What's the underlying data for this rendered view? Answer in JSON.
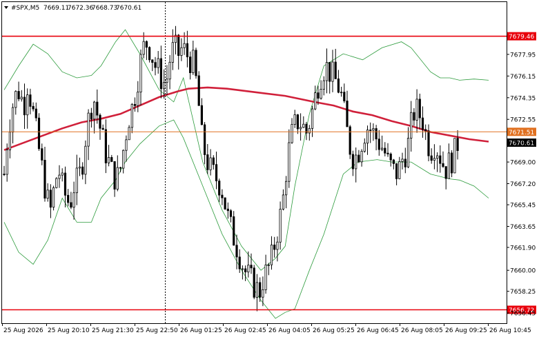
{
  "header": {
    "symbol": "#SPX,M5",
    "open": "7669.11",
    "high": "7672.36",
    "low": "7668.73",
    "close": "7670.61"
  },
  "chart_data": {
    "type": "candlestick",
    "symbol": "#SPX",
    "timeframe": "M5",
    "grid": false,
    "ylim": [
      7655.6,
      7682.3
    ],
    "y_ticks": [
      "7677.95",
      "7676.15",
      "7674.35",
      "7672.55",
      "7670.75",
      "7669.00",
      "7667.20",
      "7665.45",
      "7663.65",
      "7661.90",
      "7660.00",
      "7658.25",
      "7656.45"
    ],
    "x_ticks": [
      "25 Aug 2026",
      "25 Aug 20:10",
      "25 Aug 21:30",
      "25 Aug 22:50",
      "26 Aug 01:25",
      "26 Aug 02:45",
      "26 Aug 04:05",
      "26 Aug 05:25",
      "26 Aug 06:45",
      "26 Aug 08:05",
      "26 Aug 09:25",
      "26 Aug 10:45"
    ],
    "levels": [
      {
        "value": "7679.46",
        "color": "#e8000b"
      },
      {
        "value": "7671.51",
        "color": "#e07020"
      },
      {
        "value": "7656.72",
        "color": "#e8000b"
      }
    ],
    "current_price": "7670.61",
    "indicators": {
      "moving_average_color": "#d0203a",
      "bollinger_color": "#2a9a3a",
      "moving_average": [
        [
          0,
          7670.0
        ],
        [
          20,
          7670.6
        ],
        [
          40,
          7671.2
        ],
        [
          60,
          7671.8
        ],
        [
          80,
          7672.3
        ],
        [
          100,
          7672.6
        ],
        [
          120,
          7673.0
        ],
        [
          140,
          7673.7
        ],
        [
          160,
          7674.4
        ],
        [
          180,
          7674.9
        ],
        [
          190,
          7675.1
        ],
        [
          210,
          7675.2
        ],
        [
          230,
          7675.1
        ],
        [
          260,
          7674.8
        ],
        [
          290,
          7674.5
        ],
        [
          320,
          7674.0
        ],
        [
          340,
          7673.7
        ],
        [
          360,
          7673.2
        ],
        [
          380,
          7672.9
        ],
        [
          400,
          7672.4
        ],
        [
          420,
          7672.0
        ],
        [
          440,
          7671.5
        ],
        [
          460,
          7671.2
        ],
        [
          480,
          7670.9
        ],
        [
          500,
          7670.7
        ]
      ],
      "bollinger_upper": [
        [
          0,
          7675.0
        ],
        [
          15,
          7677.0
        ],
        [
          30,
          7678.8
        ],
        [
          45,
          7678.0
        ],
        [
          60,
          7676.5
        ],
        [
          75,
          7676.0
        ],
        [
          90,
          7676.2
        ],
        [
          100,
          7677.0
        ],
        [
          115,
          7679.0
        ],
        [
          125,
          7680.0
        ],
        [
          140,
          7678.0
        ],
        [
          160,
          7675.0
        ],
        [
          175,
          7674.0
        ],
        [
          185,
          7676.0
        ],
        [
          205,
          7669.0
        ],
        [
          225,
          7665.0
        ],
        [
          245,
          7662.0
        ],
        [
          265,
          7660.0
        ],
        [
          280,
          7661.0
        ],
        [
          290,
          7662.0
        ],
        [
          300,
          7667.0
        ],
        [
          315,
          7673.0
        ],
        [
          330,
          7677.0
        ],
        [
          350,
          7678.0
        ],
        [
          370,
          7677.5
        ],
        [
          390,
          7678.5
        ],
        [
          410,
          7679.0
        ],
        [
          420,
          7678.5
        ],
        [
          440,
          7676.5
        ],
        [
          450,
          7676.0
        ],
        [
          460,
          7676.0
        ],
        [
          470,
          7675.8
        ],
        [
          485,
          7675.9
        ],
        [
          500,
          7675.8
        ]
      ],
      "bollinger_lower": [
        [
          0,
          7664.0
        ],
        [
          15,
          7661.5
        ],
        [
          30,
          7660.5
        ],
        [
          45,
          7662.5
        ],
        [
          60,
          7666.0
        ],
        [
          75,
          7664.0
        ],
        [
          90,
          7664.0
        ],
        [
          100,
          7666.0
        ],
        [
          115,
          7667.5
        ],
        [
          125,
          7669.0
        ],
        [
          140,
          7670.5
        ],
        [
          160,
          7672.0
        ],
        [
          175,
          7672.5
        ],
        [
          185,
          7671.0
        ],
        [
          205,
          7667.0
        ],
        [
          225,
          7663.0
        ],
        [
          245,
          7660.0
        ],
        [
          265,
          7657.5
        ],
        [
          280,
          7656.0
        ],
        [
          290,
          7656.5
        ],
        [
          300,
          7656.8
        ],
        [
          315,
          7660.0
        ],
        [
          330,
          7663.0
        ],
        [
          350,
          7668.0
        ],
        [
          365,
          7669.0
        ],
        [
          385,
          7669.2
        ],
        [
          400,
          7669.0
        ],
        [
          420,
          7669.0
        ],
        [
          440,
          7668.0
        ],
        [
          450,
          7667.8
        ],
        [
          460,
          7667.6
        ],
        [
          470,
          7667.5
        ],
        [
          485,
          7667.0
        ],
        [
          500,
          7666.0
        ]
      ]
    },
    "candle_path": [
      [
        0,
        7668.0
      ],
      [
        4,
        7671.5
      ],
      [
        8,
        7673.5
      ],
      [
        12,
        7674.5
      ],
      [
        16,
        7675.0
      ],
      [
        20,
        7673.5
      ],
      [
        24,
        7675.5
      ],
      [
        28,
        7674.0
      ],
      [
        32,
        7672.0
      ],
      [
        36,
        7670.0
      ],
      [
        40,
        7668.0
      ],
      [
        44,
        7666.0
      ],
      [
        48,
        7665.0
      ],
      [
        52,
        7667.0
      ],
      [
        56,
        7668.5
      ],
      [
        60,
        7667.0
      ],
      [
        64,
        7666.0
      ],
      [
        68,
        7665.5
      ],
      [
        72,
        7667.0
      ],
      [
        76,
        7667.5
      ],
      [
        80,
        7668.5
      ],
      [
        84,
        7671.0
      ],
      [
        88,
        7673.0
      ],
      [
        92,
        7674.5
      ],
      [
        96,
        7673.0
      ],
      [
        100,
        7671.5
      ],
      [
        104,
        7670.0
      ],
      [
        108,
        7669.0
      ],
      [
        112,
        7668.0
      ],
      [
        116,
        7667.5
      ],
      [
        120,
        7668.5
      ],
      [
        124,
        7670.5
      ],
      [
        128,
        7672.5
      ],
      [
        132,
        7673.5
      ],
      [
        136,
        7675.0
      ],
      [
        140,
        7677.0
      ],
      [
        144,
        7678.5
      ],
      [
        148,
        7679.0
      ],
      [
        152,
        7678.0
      ],
      [
        156,
        7677.0
      ],
      [
        160,
        7676.5
      ],
      [
        164,
        7675.5
      ],
      [
        168,
        7676.0
      ],
      [
        172,
        7678.0
      ],
      [
        176,
        7678.5
      ],
      [
        180,
        7678.0
      ],
      [
        184,
        7678.5
      ],
      [
        188,
        7678.0
      ],
      [
        192,
        7677.5
      ],
      [
        196,
        7677.0
      ],
      [
        200,
        7674.5
      ],
      [
        204,
        7671.0
      ],
      [
        208,
        7669.5
      ],
      [
        212,
        7668.5
      ],
      [
        216,
        7668.0
      ],
      [
        220,
        7667.5
      ],
      [
        224,
        7667.0
      ],
      [
        228,
        7665.5
      ],
      [
        232,
        7664.0
      ],
      [
        236,
        7663.0
      ],
      [
        240,
        7662.0
      ],
      [
        244,
        7661.0
      ],
      [
        248,
        7660.0
      ],
      [
        252,
        7659.5
      ],
      [
        256,
        7659.0
      ],
      [
        260,
        7658.5
      ],
      [
        264,
        7658.3
      ],
      [
        268,
        7659.5
      ],
      [
        272,
        7660.0
      ],
      [
        276,
        7661.0
      ],
      [
        280,
        7662.5
      ],
      [
        284,
        7664.0
      ],
      [
        288,
        7666.0
      ],
      [
        292,
        7669.0
      ],
      [
        296,
        7671.0
      ],
      [
        300,
        7672.0
      ],
      [
        304,
        7672.5
      ],
      [
        308,
        7672.0
      ],
      [
        312,
        7671.5
      ],
      [
        316,
        7672.5
      ],
      [
        320,
        7674.0
      ],
      [
        324,
        7675.5
      ],
      [
        328,
        7676.5
      ],
      [
        332,
        7677.0
      ],
      [
        336,
        7676.5
      ],
      [
        340,
        7676.0
      ],
      [
        344,
        7675.5
      ],
      [
        348,
        7674.5
      ],
      [
        352,
        7672.5
      ],
      [
        356,
        7670.5
      ],
      [
        360,
        7669.5
      ],
      [
        364,
        7669.5
      ],
      [
        368,
        7670.5
      ],
      [
        372,
        7671.5
      ],
      [
        376,
        7672.0
      ],
      [
        380,
        7671.5
      ],
      [
        384,
        7671.0
      ],
      [
        388,
        7670.5
      ],
      [
        392,
        7670.0
      ],
      [
        396,
        7669.0
      ],
      [
        400,
        7668.5
      ],
      [
        404,
        7668.0
      ],
      [
        408,
        7668.5
      ],
      [
        412,
        7669.5
      ],
      [
        416,
        7670.0
      ],
      [
        420,
        7672.0
      ],
      [
        424,
        7673.5
      ],
      [
        428,
        7673.0
      ],
      [
        432,
        7672.5
      ],
      [
        436,
        7671.0
      ],
      [
        440,
        7670.0
      ],
      [
        444,
        7670.5
      ],
      [
        448,
        7670.0
      ],
      [
        452,
        7669.0
      ],
      [
        456,
        7668.5
      ],
      [
        460,
        7669.0
      ],
      [
        464,
        7669.5
      ],
      [
        468,
        7670.6
      ]
    ]
  }
}
